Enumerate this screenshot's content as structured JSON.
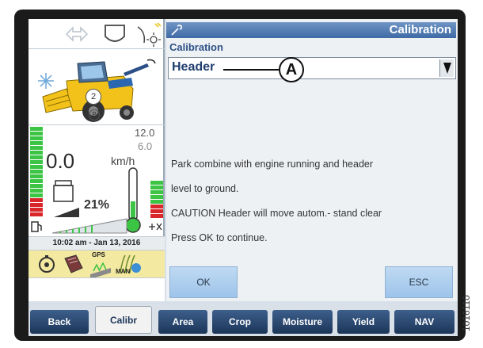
{
  "calibration": {
    "title": "Calibration",
    "section_label": "Calibration",
    "selected_item": "Header",
    "callout": "A",
    "messages": [
      "Park combine with engine running and header",
      "level to ground.",
      "CAUTION Header will move autom.- stand clear",
      "Press OK to continue."
    ],
    "ok_label": "OK",
    "esc_label": "ESC"
  },
  "status": {
    "speed_value": "0.0",
    "speed_unit": "km/h",
    "speed_max": "12.0",
    "speed_set": "6.0",
    "gear": "2",
    "park": "P",
    "fuel_percent": "21%",
    "clock": "10:02 am - Jan 13, 2016",
    "gps_label": "GPS",
    "man_label": "MAN"
  },
  "tabs": [
    {
      "label": "Back"
    },
    {
      "label": "Calibr"
    },
    {
      "label": "Area"
    },
    {
      "label": "Crop"
    },
    {
      "label": "Moisture"
    },
    {
      "label": "Yield"
    },
    {
      "label": "NAV"
    }
  ],
  "figure_id": "1016110",
  "colors": {
    "accent_blue": "#3f6aa5",
    "button_blue": "#9ec4ea",
    "tab_navy": "#1c3558",
    "combine_yellow": "#f2c21b",
    "led_green": "#3cc444",
    "led_red": "#d8262b"
  }
}
